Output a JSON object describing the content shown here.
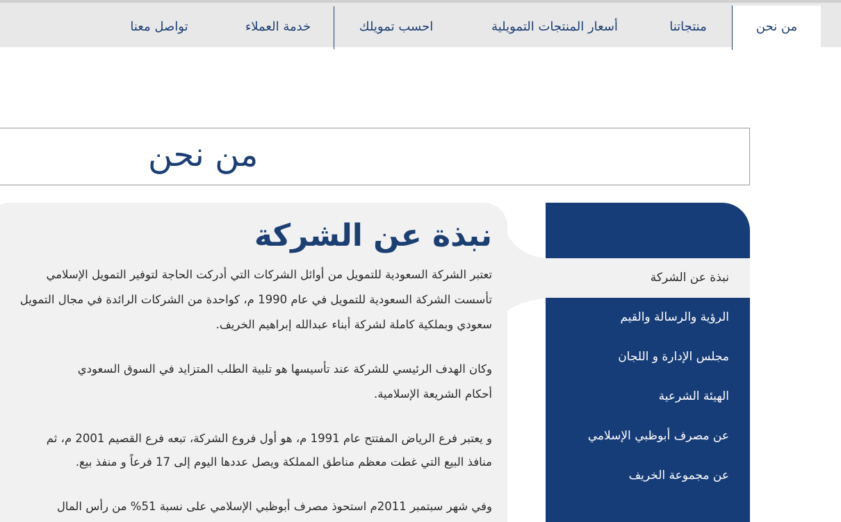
{
  "nav": {
    "items": [
      {
        "label": "من نحن",
        "active": true
      },
      {
        "label": "منتجاتنا"
      },
      {
        "label": "أسعار المنتجات التمويلية"
      },
      {
        "label": "احسب تمويلك"
      },
      {
        "label": "خدمة العملاء"
      },
      {
        "label": "تواصل معنا"
      }
    ]
  },
  "page": {
    "title": "من نحن"
  },
  "article": {
    "heading": "نبذة عن الشركة",
    "lines": [
      "تعتبر الشركة السعودية للتمويل من أوائل الشركات التي أدركت الحاجة لتوفير التمويل الإسلامي",
      "تأسست الشركة السعودية للتمويل في عام 1990 م، كواحدة من الشركات الرائدة في مجال التمويل",
      "سعودي وبملكية كاملة لشركة أبناء عبدالله إبراهيم الخريف.",
      "وكان الهدف الرئيسي للشركة عند تأسيسها هو تلبية الطلب المتزايد في السوق السعودي",
      "أحكام الشريعة الإسلامية.",
      "و يعتبر فرع الرياض المفتتح عام 1991 م، هو أول فروع الشركة، تبعه فرع القصيم 2001 م، ثم",
      "منافذ البيع التي غطت معظم مناطق المملكة ويصل عددها اليوم إلى 17 فرعاً و منفذ بيع.",
      "وفي شهر سبتمبر 2011م استحوذ مصرف أبوظبي الإسلامي على نسبة 51% من رأس المال"
    ]
  },
  "sidebar": {
    "items": [
      {
        "label": "نبذة عن الشركة",
        "active": true
      },
      {
        "label": "الرؤية والرسالة والقيم"
      },
      {
        "label": "مجلس الإدارة و اللجان"
      },
      {
        "label": "الهيئة الشرعية"
      },
      {
        "label": "عن مصرف أبوظبي الإسلامي"
      },
      {
        "label": "عن مجموعة الخريف"
      }
    ]
  },
  "colors": {
    "brand": "#173d78",
    "nav_bg": "#e8e8e8",
    "panel_bg": "#f1f1f1",
    "text": "#2b2b2b"
  }
}
